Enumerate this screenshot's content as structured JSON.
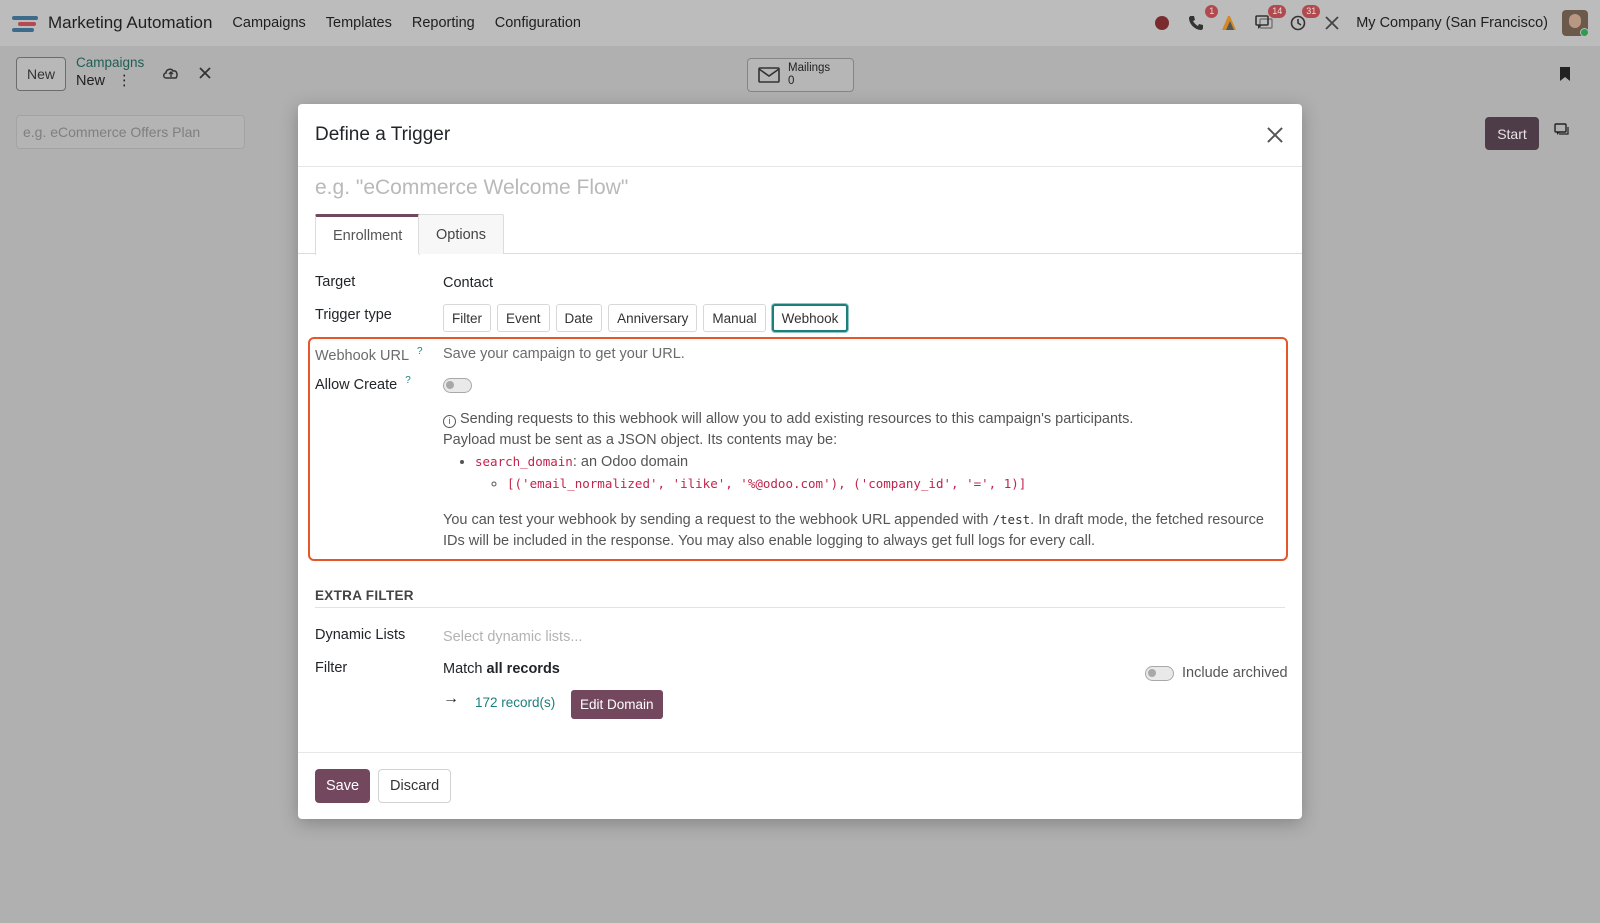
{
  "navbar": {
    "app_name": "Marketing Automation",
    "menu": [
      "Campaigns",
      "Templates",
      "Reporting",
      "Configuration"
    ],
    "badges": {
      "calls": "1",
      "messages": "14",
      "activities": "31"
    },
    "company": "My Company (San Francisco)"
  },
  "control_panel": {
    "new_label": "New",
    "breadcrumb_parent": "Campaigns",
    "breadcrumb_current": "New",
    "mailings_label": "Mailings",
    "mailings_count": "0",
    "plan_placeholder": "e.g. eCommerce Offers Plan",
    "start_label": "Start"
  },
  "modal": {
    "title": "Define a Trigger",
    "name_placeholder": "e.g. \"eCommerce Welcome Flow\"",
    "tabs": [
      "Enrollment",
      "Options"
    ],
    "target_label": "Target",
    "target_value": "Contact",
    "trigger_type_label": "Trigger type",
    "trigger_types": [
      "Filter",
      "Event",
      "Date",
      "Anniversary",
      "Manual",
      "Webhook"
    ],
    "selected_trigger": "Webhook",
    "webhook_url_label": "Webhook URL",
    "webhook_url_value": "Save your campaign to get your URL.",
    "allow_create_label": "Allow Create",
    "help_mark": "?",
    "info_line1": "Sending requests to this webhook will allow you to add existing resources to this campaign's participants.",
    "info_line2": "Payload must be sent as a JSON object. Its contents may be:",
    "info_key": "search_domain",
    "info_key_desc": ": an Odoo domain",
    "info_example": "[('email_normalized', 'ilike', '%@odoo.com'), ('company_id', '=', 1)]",
    "info_test_pre": "You can test your webhook by sending a request to the webhook URL appended with ",
    "info_test_code": "/test",
    "info_test_post": ". In draft mode, the fetched resource IDs will be included in the response. You may also enable logging to always get full logs for every call.",
    "extra_filter_title": "EXTRA FILTER",
    "dynamic_lists_label": "Dynamic Lists",
    "dynamic_lists_placeholder": "Select dynamic lists...",
    "filter_label": "Filter",
    "match_prefix": "Match",
    "match_value": "all records",
    "records_link": "172 record(s)",
    "edit_domain_label": "Edit Domain",
    "include_archived_label": "Include archived",
    "save_label": "Save",
    "discard_label": "Discard"
  },
  "colors": {
    "accent": "#73485f",
    "teal": "#1d7f7b",
    "highlight": "#e5572b"
  }
}
